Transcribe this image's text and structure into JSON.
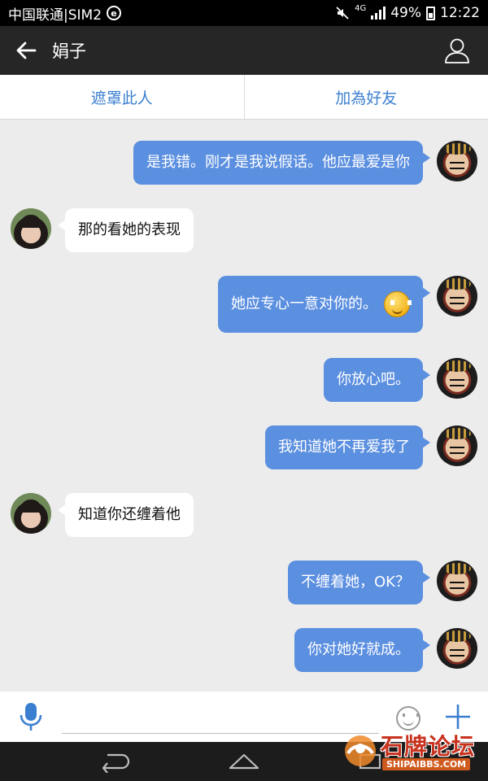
{
  "status_bar": {
    "carrier": "中国联通|SIM2",
    "network": "4G",
    "battery": "49%",
    "time": "12:22"
  },
  "header": {
    "title": "娟子"
  },
  "actions": {
    "block": "遮罩此人",
    "add_friend": "加為好友"
  },
  "messages": [
    {
      "side": "me",
      "text": "是我错。刚才是我说假话。他应最爱是你"
    },
    {
      "side": "them",
      "text": "那的看她的表现"
    },
    {
      "side": "me",
      "text": "她应专心一意对你的。",
      "emoji": "smiley-icon"
    },
    {
      "side": "me",
      "text": "你放心吧。"
    },
    {
      "side": "me",
      "text": "我知道她不再爱我了"
    },
    {
      "side": "them",
      "text": "知道你还缠着他"
    },
    {
      "side": "me",
      "text": "不缠着她，OK？"
    },
    {
      "side": "me",
      "text": "你对她好就成。"
    }
  ],
  "composer": {
    "value": "",
    "placeholder": ""
  },
  "watermark": {
    "name": "石牌论坛",
    "domain": "SHIPAIBBS.COM"
  },
  "colors": {
    "accent": "#3b7fd0",
    "my_bubble": "#5b8fe0",
    "title_bar": "#262626"
  }
}
